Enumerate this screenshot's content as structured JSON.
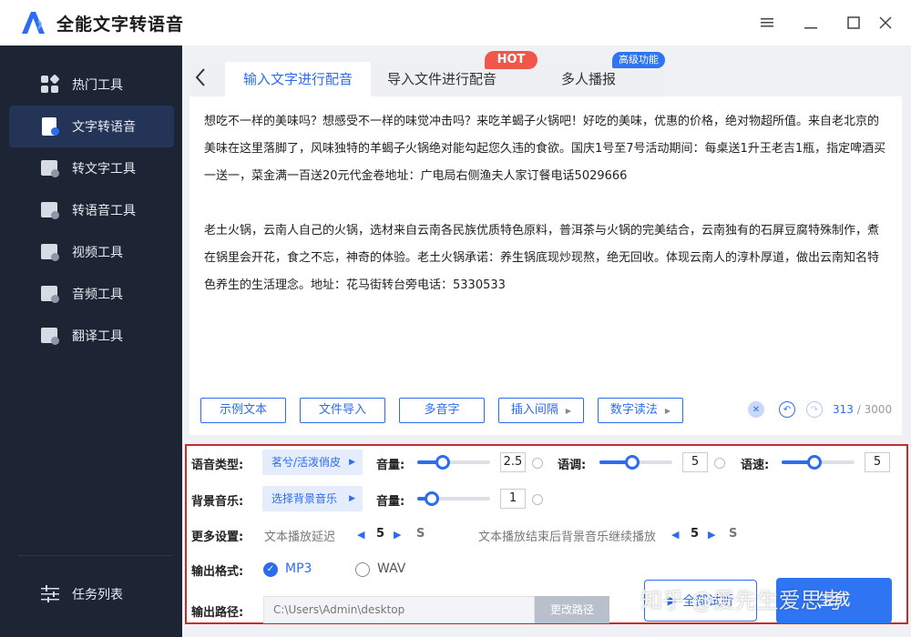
{
  "app": {
    "title": "全能文字转语音"
  },
  "window": {
    "menu_icon": "hamburger-icon",
    "minimize_icon": "minimize-icon",
    "maximize_icon": "maximize-icon",
    "close_icon": "close-icon"
  },
  "sidebar": {
    "items": [
      {
        "label": "热门工具",
        "icon": "grid-icon"
      },
      {
        "label": "文字转语音",
        "icon": "text-to-speech-icon",
        "active": true
      },
      {
        "label": "转文字工具",
        "icon": "to-text-icon"
      },
      {
        "label": "转语音工具",
        "icon": "to-speech-icon"
      },
      {
        "label": "视频工具",
        "icon": "video-icon"
      },
      {
        "label": "音频工具",
        "icon": "audio-icon"
      },
      {
        "label": "翻译工具",
        "icon": "translate-icon"
      }
    ],
    "task_list": "任务列表"
  },
  "tabs": [
    {
      "label": "输入文字进行配音",
      "active": true
    },
    {
      "label": "导入文件进行配音",
      "badge": "HOT"
    },
    {
      "label": "多人播报",
      "badge": "高级功能"
    }
  ],
  "editor": {
    "paragraphs": [
      "想吃不一样的美味吗？想感受不一样的味觉冲击吗？来吃羊蝎子火锅吧！好吃的美味，优惠的价格，绝对物超所值。来自老北京的美味在这里落脚了，风味独特的羊蝎子火锅绝对能勾起您久违的食欲。国庆1号至7号活动期间：每桌送1升王老吉1瓶，指定啤酒买一送一，菜金满一百送20元代金卷地址：广电局右侧渔夫人家订餐电话5029666",
      "老土火锅，云南人自己的火锅，选材来自云南各民族优质特色原料，普洱茶与火锅的完美结合，云南独有的石屏豆腐特殊制作，煮在锅里会开花，食之不忘，神奇的体验。老土火锅承诺：养生锅底现炒现熬，绝无回收。体现云南人的淳朴厚道，做出云南知名特色养生的生活理念。地址：花马街转台旁电话：5330533"
    ],
    "buttons": [
      "示例文本",
      "文件导入",
      "多音字",
      "插入间隔",
      "数字读法"
    ],
    "count": "313",
    "max": "/ 3000"
  },
  "settings": {
    "voice_type_label": "语音类型:",
    "voice_type_value": "茗兮/活泼俏皮",
    "volume_label": "音量:",
    "volume_value": "2.5",
    "volume_level": 0.35,
    "pitch_label": "语调:",
    "pitch_value": "5",
    "pitch_level": 0.45,
    "speed_label": "语速:",
    "speed_value": "5",
    "speed_level": 0.45,
    "bg_music_label": "背景音乐:",
    "bg_music_value": "选择背景音乐",
    "bg_volume_label": "音量:",
    "bg_volume_value": "1",
    "bg_volume_level": 0.2,
    "more_label": "更多设置:",
    "delay_label": "文本播放延迟",
    "delay_value": "5",
    "delay_unit": "S",
    "continue_label": "文本播放结束后背景音乐继续播放",
    "continue_value": "5",
    "continue_unit": "S",
    "format_label": "输出格式:",
    "format_mp3": "MP3",
    "format_wav": "WAV",
    "path_label": "输出路径:",
    "path_value": "C:\\Users\\Admin\\desktop",
    "change_path": "更改路径",
    "preview_btn": "全部试听",
    "start_btn": "生成",
    "watermark": "知乎 @爱先生爱思考"
  }
}
